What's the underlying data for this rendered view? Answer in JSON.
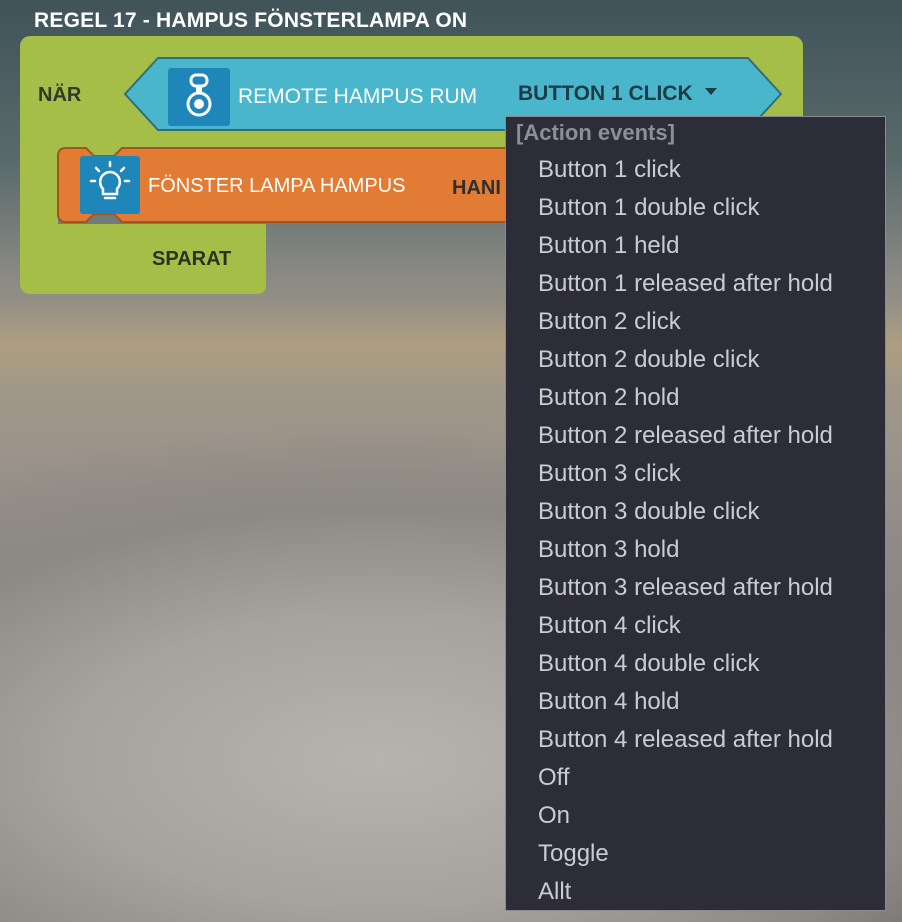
{
  "rule": {
    "title": "REGEL 17 - HAMPUS FÖNSTERLAMPA ON"
  },
  "trigger": {
    "when_label": "NÄR",
    "device_name": "REMOTE HAMPUS RUM",
    "event_value": "BUTTON 1 CLICK",
    "icon": "remote-keyfob-icon"
  },
  "action": {
    "device_name": "FÖNSTER LAMPA HAMPUS",
    "action_value_partial": "HANI",
    "icon": "lightbulb-icon"
  },
  "save_label": "SPARAT",
  "dropdown": {
    "group_header": "[Action events]",
    "options": [
      "Button 1 click",
      "Button 1 double click",
      "Button 1 held",
      "Button 1 released after hold",
      "Button 2 click",
      "Button 2 double click",
      "Button 2 hold",
      "Button 2 released after hold",
      "Button 3 click",
      "Button 3 double click",
      "Button 3 hold",
      "Button 3 released after hold",
      "Button 4 click",
      "Button 4 double click",
      "Button 4 hold",
      "Button 4 released after hold",
      "Off",
      "On",
      "Toggle",
      "Allt"
    ]
  },
  "colors": {
    "block_green": "#a4be47",
    "trigger_cyan": "#4ab6cc",
    "action_orange": "#e27b34",
    "icon_blue": "#1e86b9",
    "dropdown_bg": "#2c2d39"
  }
}
